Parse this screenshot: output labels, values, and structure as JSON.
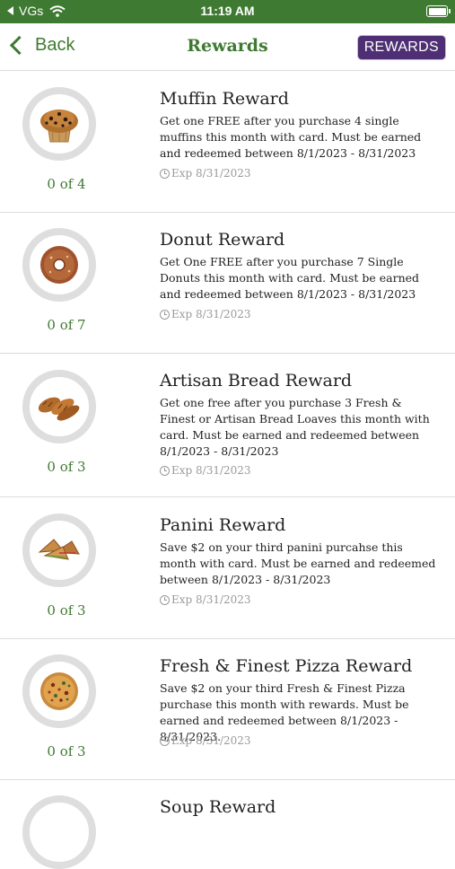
{
  "status_bar": {
    "carrier": "VGs",
    "time": "11:19 AM"
  },
  "nav": {
    "back_label": "Back",
    "title": "Rewards",
    "badge_label": "REWARDS"
  },
  "colors": {
    "brand_green": "#3f7a32",
    "badge_purple": "#4f2f73",
    "ring_gray": "#dedede"
  },
  "rewards": [
    {
      "icon": "muffin-icon",
      "progress": "0 of 4",
      "title": "Muffin Reward",
      "description": "Get one FREE after you purchase 4 single muffins this month with card.  Must be earned and redeemed between 8/1/2023 - 8/31/2023",
      "expiry": "Exp 8/31/2023"
    },
    {
      "icon": "donut-icon",
      "progress": "0 of 7",
      "title": "Donut Reward",
      "description": "Get One FREE after you purchase 7 Single Donuts this month with card. Must be earned and redeemed between 8/1/2023 - 8/31/2023",
      "expiry": "Exp 8/31/2023"
    },
    {
      "icon": "bread-icon",
      "progress": "0 of 3",
      "title": "Artisan Bread Reward",
      "description": "Get one free after you purchase 3 Fresh & Finest or Artisan Bread Loaves this month with card. Must be earned and redeemed between 8/1/2023 - 8/31/2023",
      "expiry": "Exp 8/31/2023"
    },
    {
      "icon": "panini-icon",
      "progress": "0 of 3",
      "title": "Panini Reward",
      "description": "Save $2 on your third panini purcahse this month with card. Must be earned and redeemed between 8/1/2023 - 8/31/2023",
      "expiry": "Exp 8/31/2023"
    },
    {
      "icon": "pizza-icon",
      "progress": "0 of 3",
      "title": "Fresh & Finest Pizza Reward",
      "description": "Save $2 on your third Fresh & Finest Pizza purchase this month with rewards. Must be earned and redeemed between 8/1/2023 - 8/31/2023.",
      "expiry": "Exp 8/31/2023"
    },
    {
      "icon": "soup-icon",
      "progress": "",
      "title": "Soup Reward",
      "description": "",
      "expiry": ""
    }
  ]
}
